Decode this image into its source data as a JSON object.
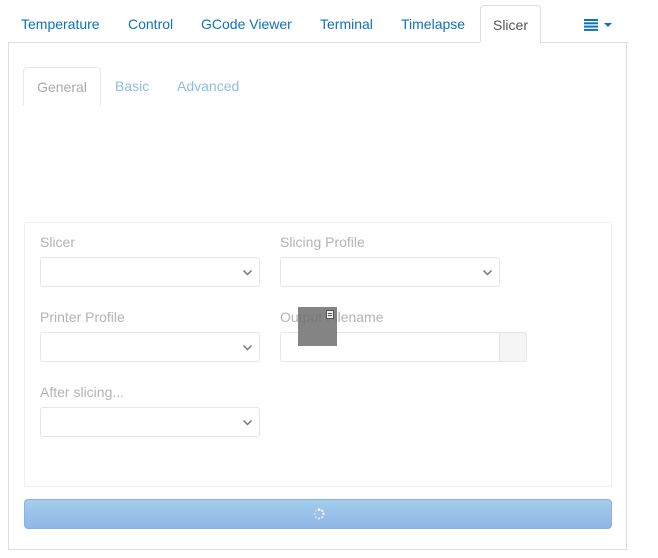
{
  "top_tabs": [
    {
      "label": "Temperature"
    },
    {
      "label": "Control"
    },
    {
      "label": "GCode Viewer"
    },
    {
      "label": "Terminal"
    },
    {
      "label": "Timelapse"
    },
    {
      "label": "Slicer",
      "active": true
    }
  ],
  "sub_tabs": [
    {
      "label": "General",
      "active": true
    },
    {
      "label": "Basic"
    },
    {
      "label": "Advanced"
    }
  ],
  "form": {
    "slicer_label": "Slicer",
    "slicing_profile_label": "Slicing Profile",
    "printer_profile_label": "Printer Profile",
    "output_filename_label": "Output Filename",
    "after_slicing_label": "After slicing...",
    "slicer_value": "",
    "slicing_profile_value": "",
    "printer_profile_value": "",
    "output_filename_value": "",
    "after_slicing_value": ""
  },
  "colors": {
    "link": "#0e72b8",
    "sub_tab_inactive": "#8dbde0",
    "button_top": "#a4cdee",
    "button_bottom": "#90b6e4"
  },
  "icons": {
    "menu": "list-icon",
    "select": "chevron-down-icon",
    "button": "spinner-icon"
  }
}
